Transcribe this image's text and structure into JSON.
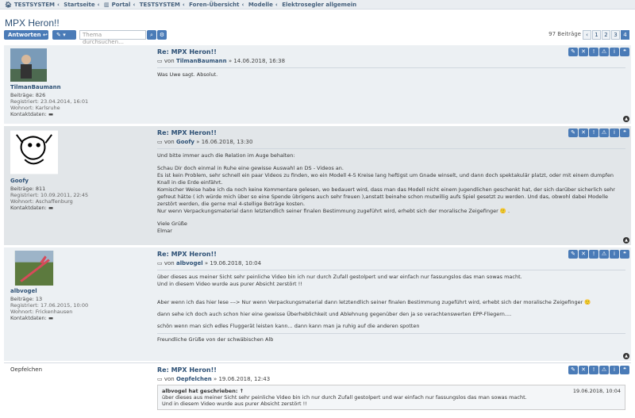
{
  "breadcrumb": [
    "TESTSYSTEM",
    "Startseite",
    "Portal",
    "TESTSYSTEM",
    "Foren-Übersicht",
    "Modelle",
    "Elektrosegler allgemein"
  ],
  "page_title": "MPX Heron!!",
  "toolbar": {
    "reply_label": "Antworten",
    "search_placeholder": "Thema durchsuchen…",
    "post_count": "97 Beiträge",
    "pages": [
      "1",
      "2",
      "3",
      "4"
    ],
    "active_page": "4"
  },
  "posts": [
    {
      "title": "Re: MPX Heron!!",
      "by": "von",
      "user": "TilmanBaumann",
      "date": "» 14.06.2018, 16:38",
      "meta": [
        "Beiträge: 826",
        "Registriert: 23.04.2014, 16:01",
        "Wohnort: Karlsruhe",
        "Kontaktdaten:"
      ],
      "text": [
        "Was Uwe sagt. Absolut."
      ]
    },
    {
      "title": "Re: MPX Heron!!",
      "by": "von",
      "user": "Goofy",
      "date": "» 16.06.2018, 13:30",
      "meta": [
        "Beiträge: 811",
        "Registriert: 10.09.2011, 22:45",
        "Wohnort: Aschaffenburg",
        "Kontaktdaten:"
      ],
      "text": [
        "Und bitte immer auch die Relation im Auge behalten:",
        "",
        "Schau Dir doch einmal in Ruhe eine gewisse Auswahl an DS - Videos an.",
        "Es ist kein Problem, sehr schnell ein paar Videos zu finden, wo ein Modell 4-5 Kreise lang heftigst um Gnade winselt, und dann doch spektakulär platzt, oder mit einem dumpfen Knall in die Erde einfährt.",
        "Komischer Weise habe ich da noch keine Kommentare gelesen, wo bedauert wird, dass man das Modell nicht einem Jugendlichen geschenkt hat, der sich darüber sicherlich sehr gefreut hätte ( ich würde mich über so eine Spende übrigens auch sehr freuen ),anstatt beinahe schon mutwillig aufs Spiel gesetzt zu werden. Und das, obwohl dabei Modelle zerstört werden, die gerne mal 4-stellige Beträge kosten.",
        "Nur wenn Verpackungsmaterial dann letztendlich seiner finalen Bestimmung zugeführt wird, erhebt sich der moralische Zeigefinger 🙂 .",
        "",
        "Viele Grüße",
        "Elmar"
      ]
    },
    {
      "title": "Re: MPX Heron!!",
      "by": "von",
      "user": "albvogel",
      "date": "» 19.06.2018, 10:04",
      "meta": [
        "Beiträge: 13",
        "Registriert: 17.06.2015, 10:00",
        "Wohnort: Frickenhausen",
        "Kontaktdaten:"
      ],
      "text": [
        "über dieses aus meiner Sicht sehr peinliche Video bin ich nur durch Zufall gestolpert und war einfach nur fassungslos das man sowas macht.",
        "Und in diesem Video wurde aus purer Absicht zerstört !!",
        "",
        "",
        "Aber wenn ich das hier lese ---> Nur wenn Verpackungsmaterial dann letztendlich seiner finalen Bestimmung zugeführt wird, erhebt sich der moralische Zeigefinger 🙂",
        "",
        "dann sehe ich doch auch schon hier eine gewisse Überheblichkeit und Ablehnung gegenüber den ja so verachtenswerten EPP-Fliegern....",
        "",
        "schön wenn man sich edles Fluggerät leisten kann... dann kann man ja ruhig auf die anderen spotten",
        "",
        "Freundliche Grüße von der schwäbischen Alb"
      ]
    },
    {
      "title": "Re: MPX Heron!!",
      "by": "von",
      "user": "Oepfelchen",
      "date": "» 19.06.2018, 12:43",
      "meta": [],
      "quote_head": "albvogel hat geschrieben: ↑",
      "quote_date": "19.06.2018, 10:04",
      "quote_lines": [
        "über dieses aus meiner Sicht sehr peinliche Video bin ich nur durch Zufall gestolpert und war einfach nur fassungslos das man sowas macht.",
        "Und in diesem Video wurde aus purer Absicht zerstört !!"
      ]
    }
  ],
  "colors": {
    "accent": "#4a7bb7",
    "title": "#2d5075"
  },
  "icons": [
    "home-icon",
    "portal-icon",
    "reply-icon",
    "wrench-icon",
    "search-icon",
    "gear-icon",
    "edit-icon",
    "delete-icon",
    "report-icon",
    "warning-icon",
    "info-icon",
    "quote-icon",
    "chat-icon",
    "top-icon",
    "post-icon"
  ]
}
